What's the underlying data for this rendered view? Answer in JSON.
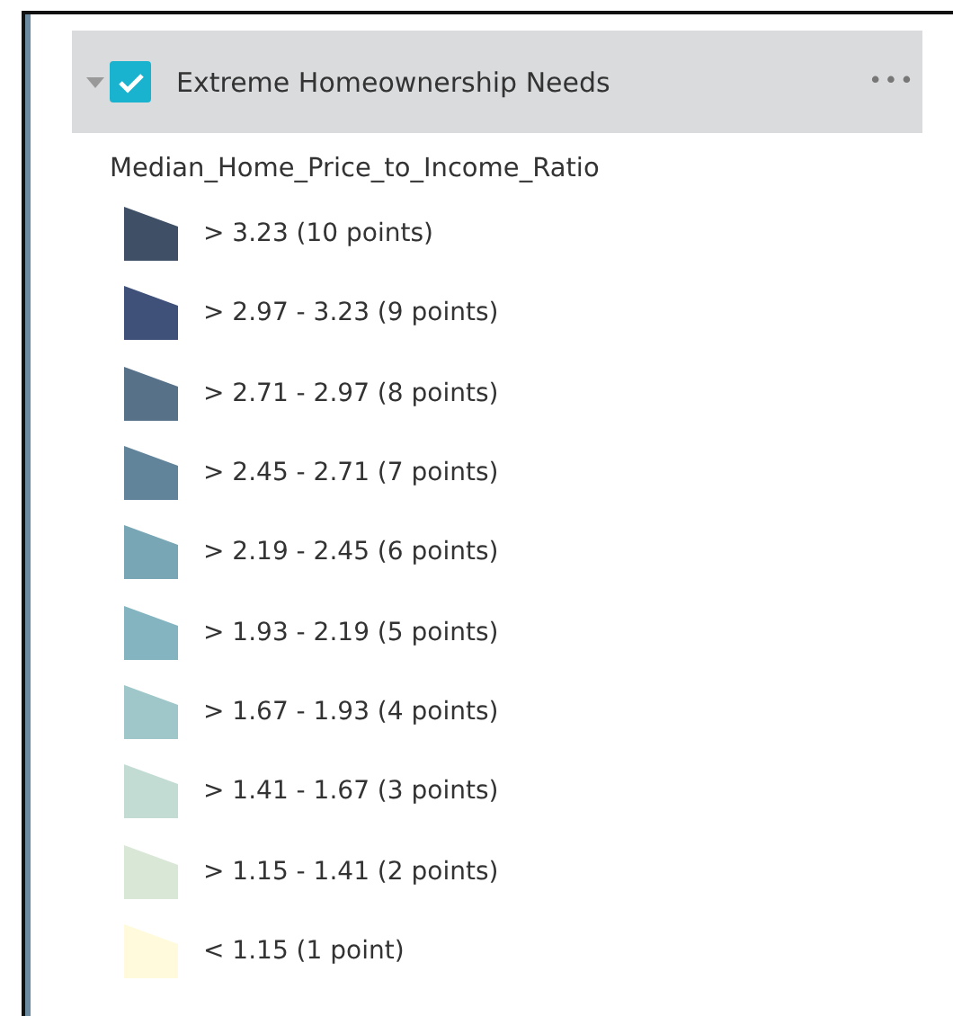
{
  "layer": {
    "title": "Extreme Homeownership Needs",
    "checked": true,
    "expanded": true,
    "more": "•••"
  },
  "legend": {
    "field": "Median_Home_Price_to_Income_Ratio",
    "items": [
      {
        "label": "> 3.23 (10 points)",
        "color": "#3e4f66"
      },
      {
        "label": "> 2.97 - 3.23 (9 points)",
        "color": "#3f5079"
      },
      {
        "label": "> 2.71 - 2.97 (8 points)",
        "color": "#577189"
      },
      {
        "label": "> 2.45 - 2.71 (7 points)",
        "color": "#62849b"
      },
      {
        "label": "> 2.19 - 2.45 (6 points)",
        "color": "#78a6b4"
      },
      {
        "label": "> 1.93 - 2.19 (5 points)",
        "color": "#84b4c0"
      },
      {
        "label": "> 1.67 - 1.93 (4 points)",
        "color": "#9fc6c9"
      },
      {
        "label": "> 1.41 - 1.67 (3 points)",
        "color": "#c3dcd3"
      },
      {
        "label": "> 1.15 - 1.41 (2 points)",
        "color": "#d9e7d6"
      },
      {
        "label": "< 1.15 (1 point)",
        "color": "#fffadb"
      }
    ]
  }
}
